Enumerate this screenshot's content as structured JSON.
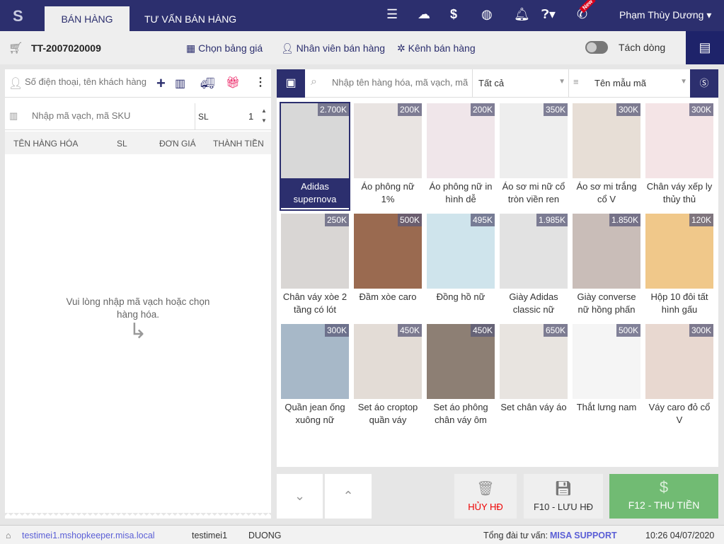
{
  "header": {
    "tabs": [
      "BÁN HÀNG",
      "TƯ VẤN BÁN HÀNG"
    ],
    "user": "Phạm Thùy Dương",
    "new_badge": "New"
  },
  "toolbar": {
    "order_no": "TT-2007020009",
    "price_list": "Chọn bảng giá",
    "staff": "Nhân viên bán hàng",
    "channel": "Kênh bán hàng",
    "split_lines": "Tách dòng"
  },
  "left": {
    "customer_placeholder": "Số điện thoại, tên khách hàng",
    "sku_placeholder": "Nhập mã vạch, mã SKU",
    "qty_label": "SL",
    "qty": "1",
    "columns": [
      "TÊN HÀNG HÓA",
      "SL",
      "ĐƠN GIÁ",
      "THÀNH TIỀN"
    ],
    "empty_line1": "Vui lòng nhập mã vạch hoặc chọn",
    "empty_line2": "hàng hóa."
  },
  "right": {
    "search_placeholder": "Nhập tên hàng hóa, mã vạch, mã",
    "category": "Tất cả",
    "sort": "Tên mẫu mã",
    "products": [
      {
        "name": "Adidas supernova",
        "price": "2.700K",
        "color": "#d8d8d8"
      },
      {
        "name": "Áo phông nữ 1%",
        "price": "200K",
        "color": "#e9e4e2"
      },
      {
        "name": "Áo phông nữ in hình dễ",
        "price": "200K",
        "color": "#f0e6ea"
      },
      {
        "name": "Áo sơ mi nữ cổ tròn viền ren",
        "price": "350K",
        "color": "#eeeeee"
      },
      {
        "name": "Áo sơ mi trắng cổ V",
        "price": "300K",
        "color": "#e7ded6"
      },
      {
        "name": "Chân váy xếp ly thủy thủ",
        "price": "300K",
        "color": "#f4e4e6"
      },
      {
        "name": "Chân váy xòe 2 tầng có lót",
        "price": "250K",
        "color": "#d9d6d4"
      },
      {
        "name": "Đầm xòe caro",
        "price": "500K",
        "color": "#9a6a50"
      },
      {
        "name": "Đồng hồ nữ",
        "price": "495K",
        "color": "#cfe4ec"
      },
      {
        "name": "Giày Adidas classic nữ",
        "price": "1.985K",
        "color": "#e2e2e2"
      },
      {
        "name": "Giày converse nữ hồng phấn",
        "price": "1.850K",
        "color": "#c9bdb8"
      },
      {
        "name": "Hộp 10 đôi tất hình gấu",
        "price": "120K",
        "color": "#f0c88a"
      },
      {
        "name": "Quần jean ống xuông nữ",
        "price": "300K",
        "color": "#a7b8c8"
      },
      {
        "name": "Set áo croptop quần váy",
        "price": "450K",
        "color": "#e3dcd6"
      },
      {
        "name": "Set áo phông chân váy ôm",
        "price": "450K",
        "color": "#8d7f74"
      },
      {
        "name": "Set chân váy áo",
        "price": "650K",
        "color": "#e8e4e0"
      },
      {
        "name": "Thắt lưng nam",
        "price": "500K",
        "color": "#f5f5f5"
      },
      {
        "name": "Váy caro đỏ cổ V",
        "price": "300K",
        "color": "#e8d8d0"
      }
    ]
  },
  "actions": {
    "cancel": "HỦY HĐ",
    "save": "F10 - LƯU HĐ",
    "pay": "F12 - THU TIỀN"
  },
  "footer": {
    "url": "testimei1.mshopkeeper.misa.local",
    "shop": "testimei1",
    "staff": "DUONG",
    "hotline_label": "Tổng đài tư vấn:",
    "hotline": "MISA SUPPORT",
    "datetime": "10:26 04/07/2020"
  }
}
